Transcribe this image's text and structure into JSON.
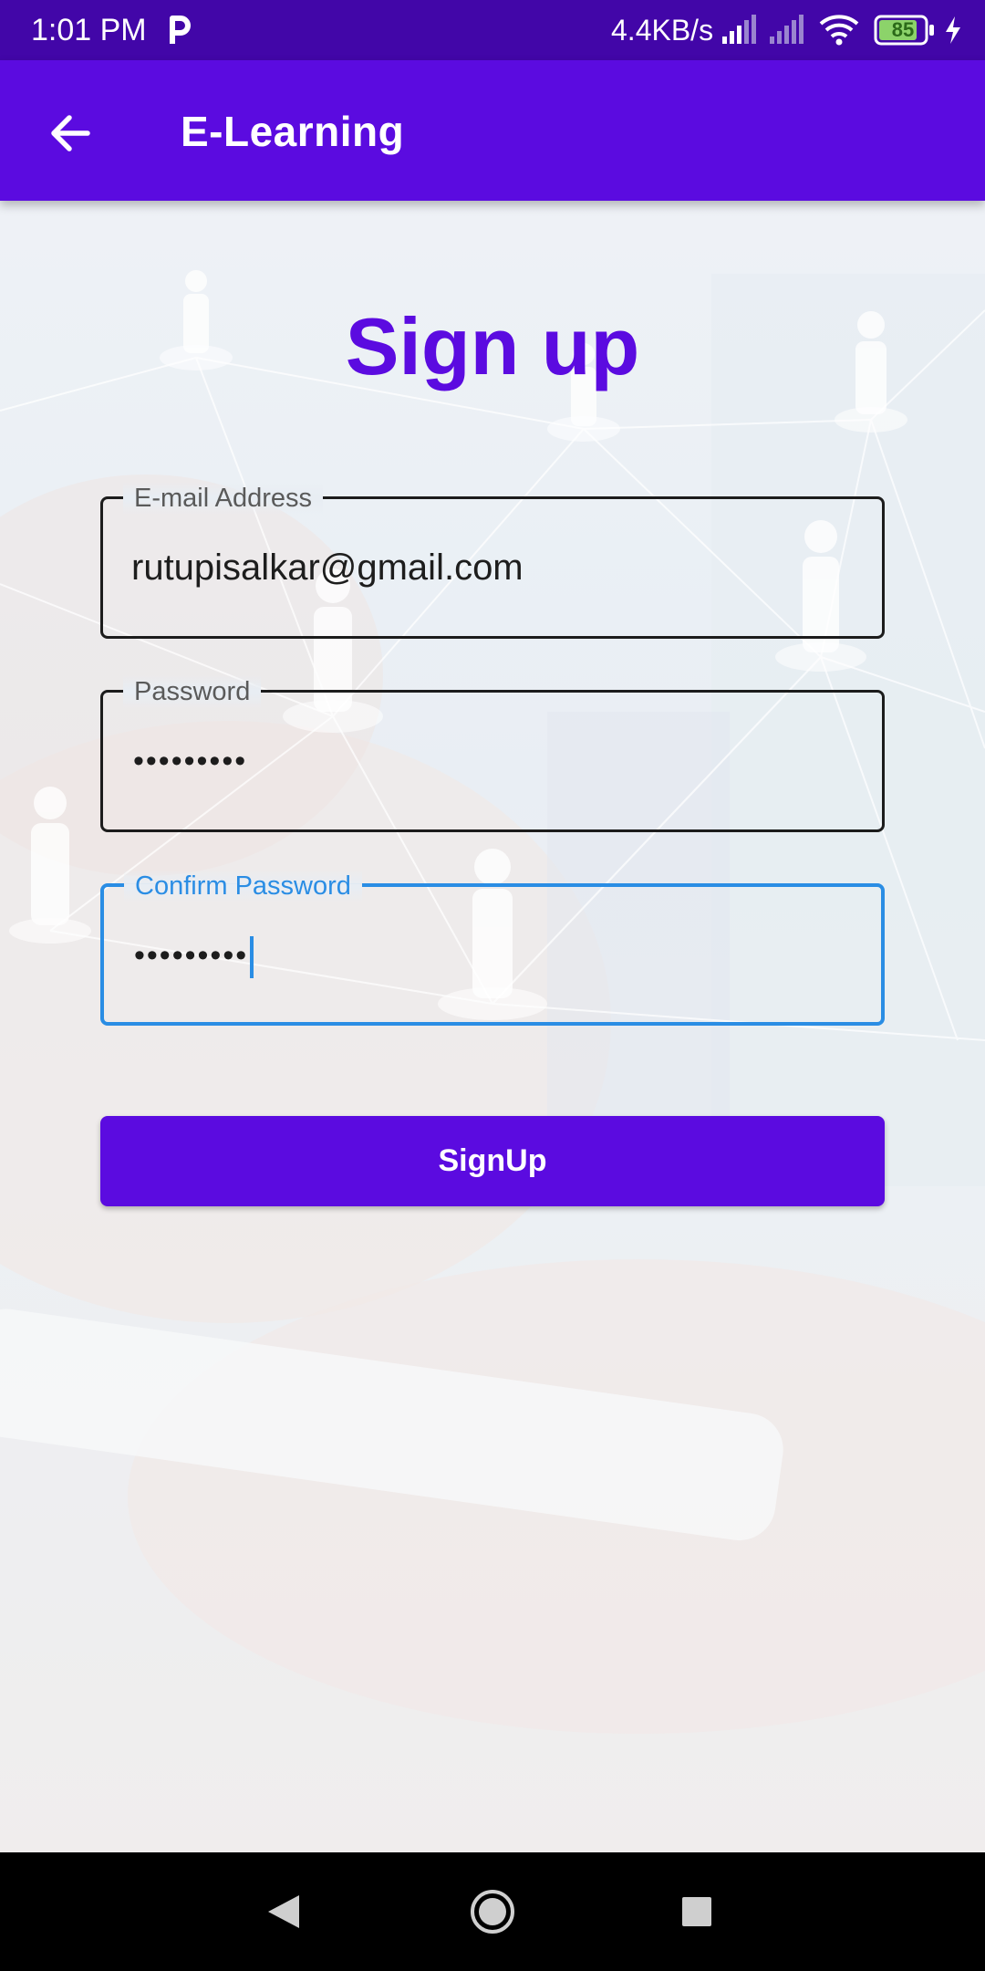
{
  "status_bar": {
    "time": "1:01 PM",
    "network_speed": "4.4KB/s",
    "battery_level": "85",
    "icons": [
      "parking-notification-icon",
      "signal-icon",
      "signal-icon",
      "wifi-icon",
      "battery-icon",
      "charging-icon"
    ]
  },
  "app_bar": {
    "title": "E-Learning",
    "back_icon": "arrow-back-icon"
  },
  "form": {
    "title": "Sign up",
    "email": {
      "label": "E-mail Address",
      "value": "rutupisalkar@gmail.com"
    },
    "password": {
      "label": "Password",
      "masked_value": "•••••••••"
    },
    "confirm_password": {
      "label": "Confirm Password",
      "masked_value": "•••••••••"
    },
    "submit_label": "SignUp"
  },
  "nav_bar": {
    "icons": [
      "back-triangle-icon",
      "home-circle-icon",
      "recents-square-icon"
    ]
  },
  "colors": {
    "status_bar": "#4206a8",
    "primary": "#5b0be0",
    "focus": "#2a8de4",
    "text": "#1d1d1d"
  }
}
